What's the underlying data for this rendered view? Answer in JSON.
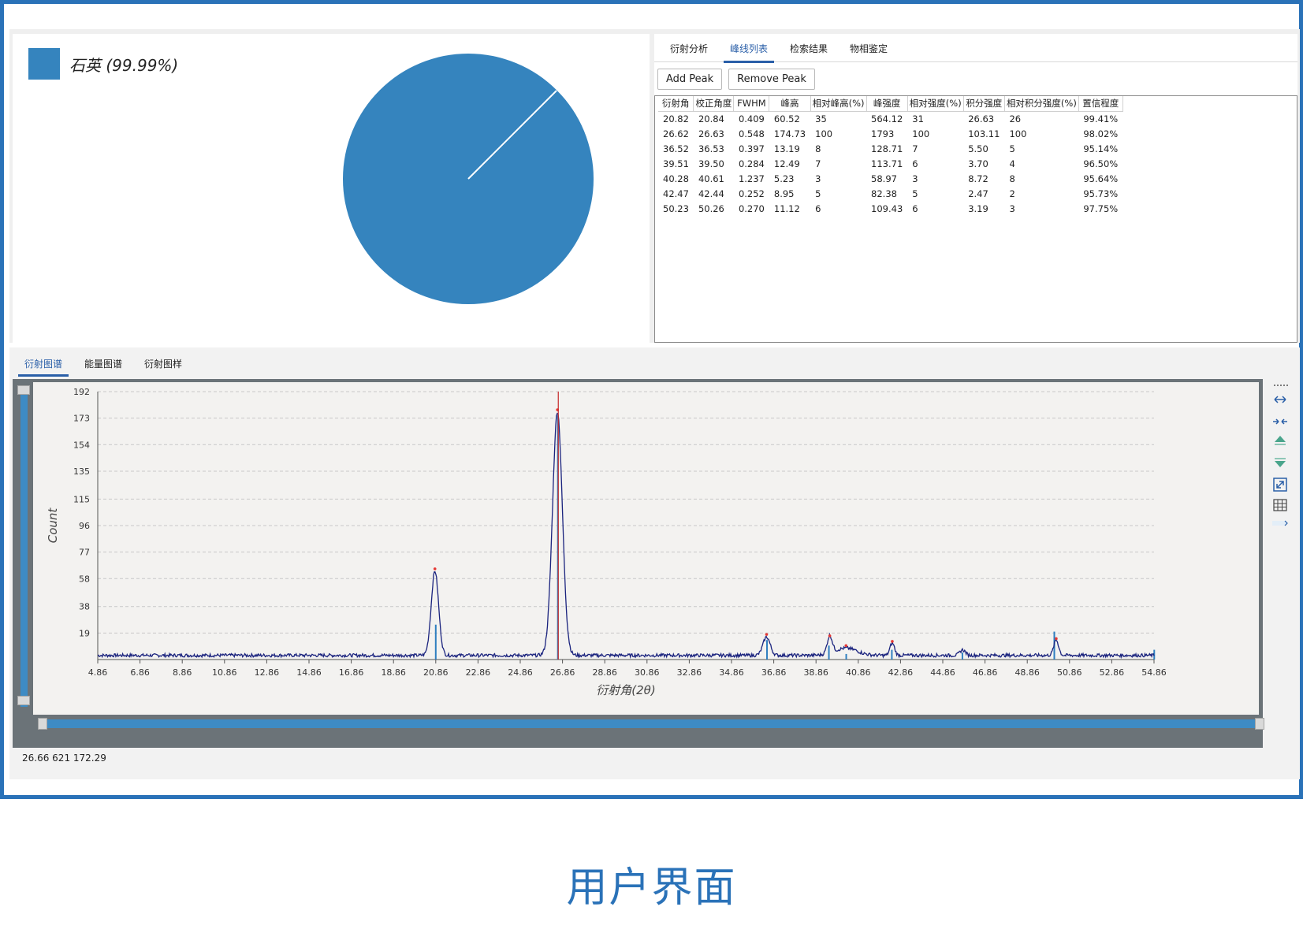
{
  "pie": {
    "legend_label": "石英 (99.99%)",
    "color": "#3584be"
  },
  "peak_panel": {
    "tabs": [
      {
        "label": "衍射分析",
        "active": false
      },
      {
        "label": "峰线列表",
        "active": true
      },
      {
        "label": "检索结果",
        "active": false
      },
      {
        "label": "物相鉴定",
        "active": false
      }
    ],
    "add_peak_label": "Add Peak",
    "remove_peak_label": "Remove Peak",
    "table": {
      "headers": [
        "衍射角",
        "校正角度",
        "FWHM",
        "峰高",
        "相对峰高(%)",
        "峰强度",
        "相对强度(%)",
        "积分强度",
        "相对积分强度(%)",
        "置信程度"
      ],
      "rows": [
        [
          "20.82",
          "20.84",
          "0.409",
          "60.52",
          "35",
          "564.12",
          "31",
          "26.63",
          "26",
          "99.41%"
        ],
        [
          "26.62",
          "26.63",
          "0.548",
          "174.73",
          "100",
          "1793",
          "100",
          "103.11",
          "100",
          "98.02%"
        ],
        [
          "36.52",
          "36.53",
          "0.397",
          "13.19",
          "8",
          "128.71",
          "7",
          "5.50",
          "5",
          "95.14%"
        ],
        [
          "39.51",
          "39.50",
          "0.284",
          "12.49",
          "7",
          "113.71",
          "6",
          "3.70",
          "4",
          "96.50%"
        ],
        [
          "40.28",
          "40.61",
          "1.237",
          "5.23",
          "3",
          "58.97",
          "3",
          "8.72",
          "8",
          "95.64%"
        ],
        [
          "42.47",
          "42.44",
          "0.252",
          "8.95",
          "5",
          "82.38",
          "5",
          "2.47",
          "2",
          "95.73%"
        ],
        [
          "50.23",
          "50.26",
          "0.270",
          "11.12",
          "6",
          "109.43",
          "6",
          "3.19",
          "3",
          "97.75%"
        ]
      ]
    }
  },
  "bottom_tabs": [
    {
      "label": "衍射图谱",
      "active": true
    },
    {
      "label": "能量图谱",
      "active": false
    },
    {
      "label": "衍射图样",
      "active": false
    }
  ],
  "chart_data": {
    "type": "line",
    "xlabel": "衍射角(2θ)",
    "ylabel": "Count",
    "xlim": [
      4.86,
      54.86
    ],
    "ylim": [
      0,
      192
    ],
    "x_ticks": [
      "4.86",
      "6.86",
      "8.86",
      "10.86",
      "12.86",
      "14.86",
      "16.86",
      "18.86",
      "20.86",
      "22.86",
      "24.86",
      "26.86",
      "28.86",
      "30.86",
      "32.86",
      "34.86",
      "36.86",
      "38.86",
      "40.86",
      "42.86",
      "44.86",
      "46.86",
      "48.86",
      "50.86",
      "52.86",
      "54.86"
    ],
    "y_ticks": [
      "19",
      "38",
      "58",
      "77",
      "96",
      "115",
      "135",
      "154",
      "173",
      "192"
    ],
    "grid": true,
    "line_color": "#1a237e",
    "baseline": 3,
    "peaks": [
      {
        "x": 20.82,
        "height": 60.5,
        "fwhm": 0.409
      },
      {
        "x": 26.62,
        "height": 174.7,
        "fwhm": 0.548
      },
      {
        "x": 36.52,
        "height": 13.2,
        "fwhm": 0.397
      },
      {
        "x": 39.51,
        "height": 12.5,
        "fwhm": 0.284
      },
      {
        "x": 40.28,
        "height": 5.2,
        "fwhm": 1.237
      },
      {
        "x": 42.47,
        "height": 8.9,
        "fwhm": 0.252
      },
      {
        "x": 45.8,
        "height": 4,
        "fwhm": 0.3
      },
      {
        "x": 50.23,
        "height": 11.1,
        "fwhm": 0.27
      }
    ],
    "reference_sticks": [
      {
        "x": 20.86,
        "value": 25
      },
      {
        "x": 26.64,
        "value": 175
      },
      {
        "x": 36.54,
        "value": 14
      },
      {
        "x": 39.47,
        "value": 10
      },
      {
        "x": 40.29,
        "value": 4
      },
      {
        "x": 42.45,
        "value": 7
      },
      {
        "x": 45.79,
        "value": 5
      },
      {
        "x": 50.14,
        "value": 20
      },
      {
        "x": 54.87,
        "value": 7
      }
    ],
    "marker_points": [
      {
        "x": 20.82,
        "value": 65
      },
      {
        "x": 26.62,
        "value": 179
      },
      {
        "x": 36.52,
        "value": 18
      },
      {
        "x": 39.51,
        "value": 17
      },
      {
        "x": 40.28,
        "value": 10
      },
      {
        "x": 42.47,
        "value": 13
      },
      {
        "x": 50.23,
        "value": 15
      }
    ],
    "cursor_x": 26.66,
    "cursor_color": "#c62828"
  },
  "status": {
    "text": "26.66  621  172.29"
  },
  "caption": "用户界面"
}
